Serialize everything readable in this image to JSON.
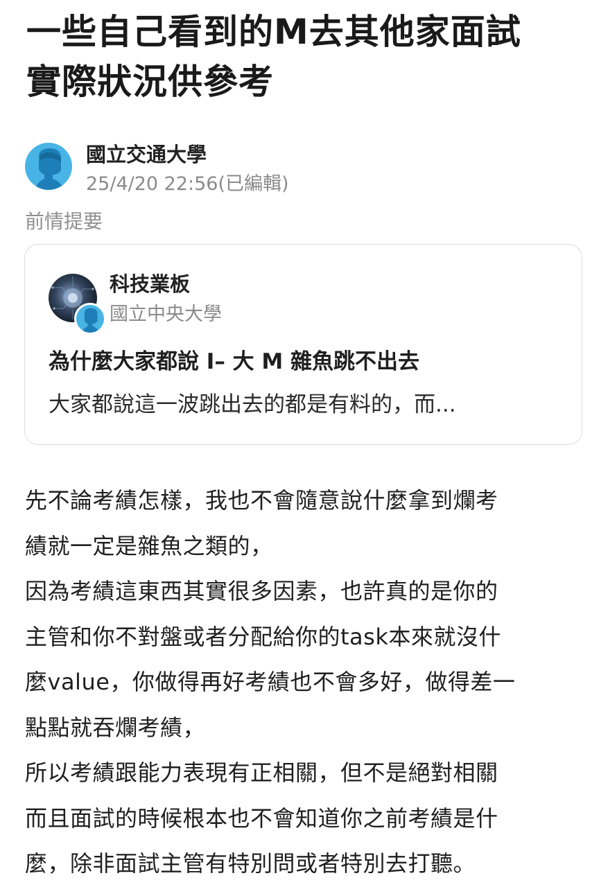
{
  "post": {
    "title_line1": "一些自己看到的M去其他家面試",
    "title_line2": "實際狀況供參考",
    "author": "國立交通大學",
    "time": "25/4/20 22:56(已編輯)"
  },
  "section_label": "前情提要",
  "quote": {
    "board": "科技業板",
    "school": "國立中央大學",
    "title": "為什麼大家都說 I– 大 M 雜魚跳不出去",
    "excerpt": "大家都說這一波跳出去的都是有料的，而..."
  },
  "body_lines": [
    "先不論考績怎樣，我也不會隨意說什麼拿到爛考",
    "績就一定是雜魚之類的，",
    "因為考績這東西其實很多因素，也許真的是你的",
    "主管和你不對盤或者分配給你的task本來就沒什",
    "麼value，你做得再好考績也不會多好，做得差一",
    "點點就吞爛考績，",
    "所以考績跟能力表現有正相關，但不是絕對相關",
    "而且面試的時候根本也不會知道你之前考績是什",
    "麼，除非面試主管有特別問或者特別去打聽。"
  ],
  "colors": {
    "avatar_blue": "#48b4e6",
    "avatar_figure": "#1e7fb8",
    "meta_gray": "#8a8a8a",
    "card_border": "#dcdcdc"
  },
  "icons": {
    "author_avatar": "user-silhouette-icon",
    "board_avatar": "tech-board-icon"
  }
}
